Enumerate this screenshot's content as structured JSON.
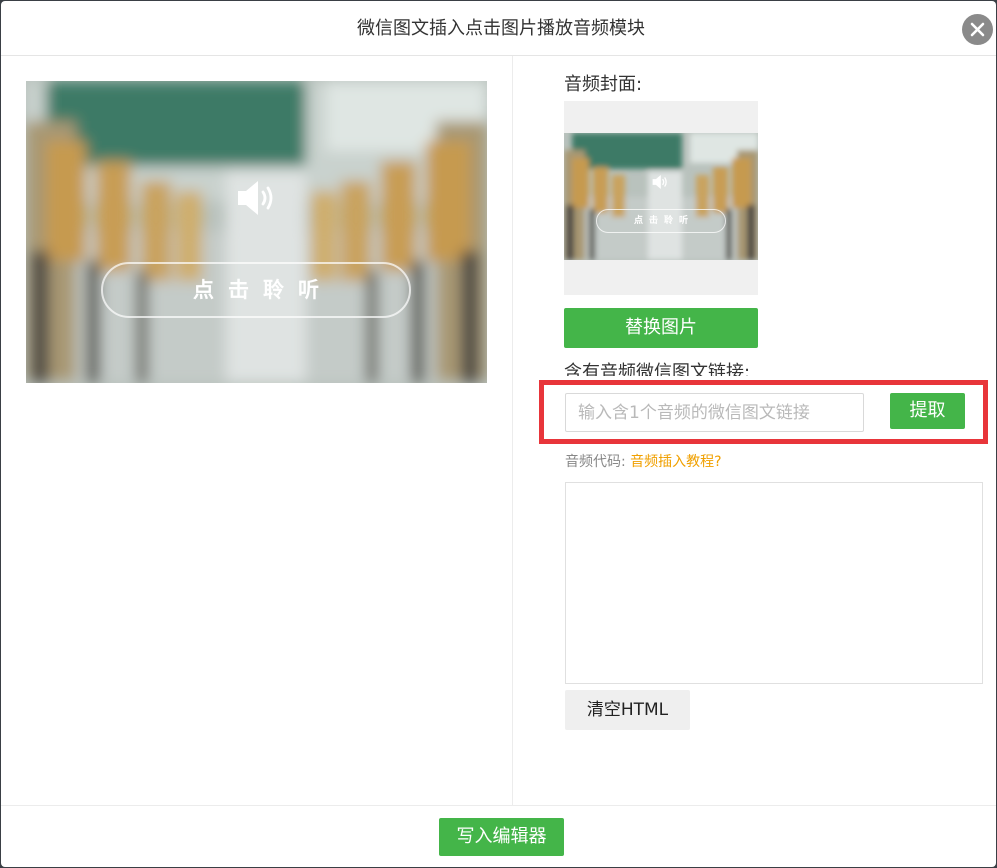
{
  "dialog": {
    "title": "微信图文插入点击图片播放音频模块",
    "close_icon": "close-icon"
  },
  "preview": {
    "speaker_icon": "speaker-icon",
    "listen_label": "点击聆听"
  },
  "cover": {
    "label": "音频封面:",
    "thumb_listen_label": "点击聆听",
    "replace_button": "替换图片"
  },
  "link": {
    "label": "含有音频微信图文链接:",
    "placeholder": "输入含1个音频的微信图文链接",
    "value": "",
    "extract_button": "提取",
    "highlight_color": "#e8353a"
  },
  "code": {
    "label": "音频代码:",
    "tutorial_link": "音频插入教程?",
    "value": "",
    "clear_button": "清空HTML"
  },
  "footer": {
    "write_button": "写入编辑器"
  },
  "colors": {
    "primary_green": "#44b549",
    "tutorial_orange": "#f0a000"
  }
}
